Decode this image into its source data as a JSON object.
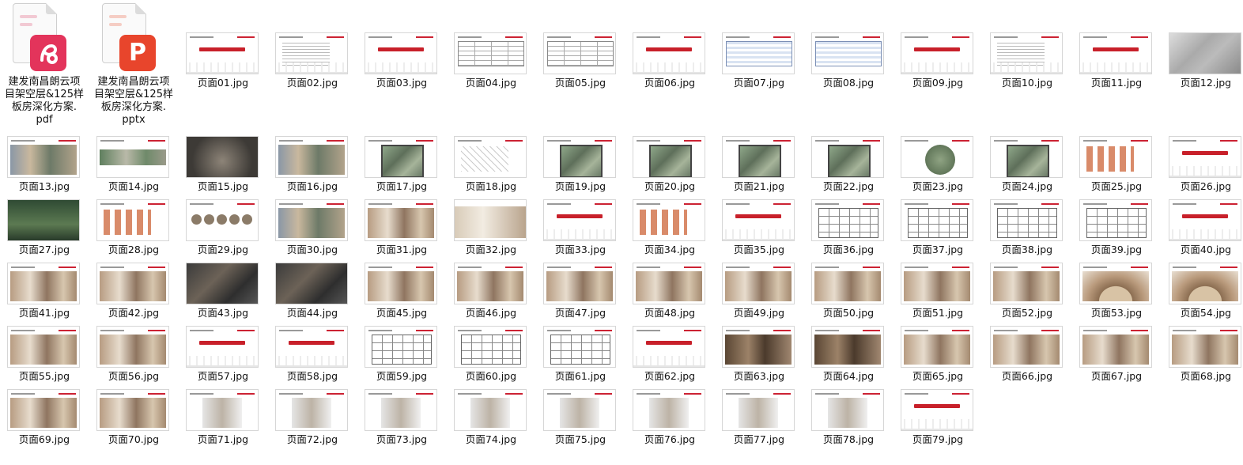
{
  "files": [
    {
      "name_lines": [
        "建发南昌朗云项",
        "目架空层&125样",
        "板房深化方案.",
        "pdf"
      ],
      "type": "pdf",
      "icon": "pdf-file-icon",
      "accent": "#e3345b",
      "glyph": "P"
    },
    {
      "name_lines": [
        "建发南昌朗云项",
        "目架空层&125样",
        "板房深化方案.",
        "pptx"
      ],
      "type": "pptx",
      "icon": "pptx-file-icon",
      "accent": "#e8452c",
      "glyph": "P"
    }
  ],
  "thumbnails": [
    {
      "label": "页面01.jpg",
      "kind": "cover"
    },
    {
      "label": "页面02.jpg",
      "kind": "lines"
    },
    {
      "label": "页面03.jpg",
      "kind": "cover"
    },
    {
      "label": "页面04.jpg",
      "kind": "table"
    },
    {
      "label": "页面05.jpg",
      "kind": "table"
    },
    {
      "label": "页面06.jpg",
      "kind": "cover"
    },
    {
      "label": "页面07.jpg",
      "kind": "bluetable"
    },
    {
      "label": "页面08.jpg",
      "kind": "bluetable"
    },
    {
      "label": "页面09.jpg",
      "kind": "cover"
    },
    {
      "label": "页面10.jpg",
      "kind": "lines"
    },
    {
      "label": "页面11.jpg",
      "kind": "cover"
    },
    {
      "label": "页面12.jpg",
      "kind": "map"
    },
    {
      "label": "页面13.jpg",
      "kind": "photo"
    },
    {
      "label": "页面14.jpg",
      "kind": "photo-green"
    },
    {
      "label": "页面15.jpg",
      "kind": "dark"
    },
    {
      "label": "页面16.jpg",
      "kind": "photo"
    },
    {
      "label": "页面17.jpg",
      "kind": "siteplan"
    },
    {
      "label": "页面18.jpg",
      "kind": "sketch"
    },
    {
      "label": "页面19.jpg",
      "kind": "siteplan"
    },
    {
      "label": "页面20.jpg",
      "kind": "siteplan"
    },
    {
      "label": "页面21.jpg",
      "kind": "siteplan"
    },
    {
      "label": "页面22.jpg",
      "kind": "siteplan"
    },
    {
      "label": "页面23.jpg",
      "kind": "circle"
    },
    {
      "label": "页面24.jpg",
      "kind": "siteplan"
    },
    {
      "label": "页面25.jpg",
      "kind": "diagram"
    },
    {
      "label": "页面26.jpg",
      "kind": "cover"
    },
    {
      "label": "页面27.jpg",
      "kind": "dark-green"
    },
    {
      "label": "页面28.jpg",
      "kind": "diagram"
    },
    {
      "label": "页面29.jpg",
      "kind": "circles"
    },
    {
      "label": "页面30.jpg",
      "kind": "photo"
    },
    {
      "label": "页面31.jpg",
      "kind": "interior"
    },
    {
      "label": "页面32.jpg",
      "kind": "interior-wide"
    },
    {
      "label": "页面33.jpg",
      "kind": "cover"
    },
    {
      "label": "页面34.jpg",
      "kind": "diagram"
    },
    {
      "label": "页面35.jpg",
      "kind": "cover"
    },
    {
      "label": "页面36.jpg",
      "kind": "plan"
    },
    {
      "label": "页面37.jpg",
      "kind": "plan"
    },
    {
      "label": "页面38.jpg",
      "kind": "plan"
    },
    {
      "label": "页面39.jpg",
      "kind": "plan"
    },
    {
      "label": "页面40.jpg",
      "kind": "cover"
    },
    {
      "label": "页面41.jpg",
      "kind": "interior"
    },
    {
      "label": "页面42.jpg",
      "kind": "interior"
    },
    {
      "label": "页面43.jpg",
      "kind": "model"
    },
    {
      "label": "页面44.jpg",
      "kind": "model"
    },
    {
      "label": "页面45.jpg",
      "kind": "interior"
    },
    {
      "label": "页面46.jpg",
      "kind": "interior"
    },
    {
      "label": "页面47.jpg",
      "kind": "interior"
    },
    {
      "label": "页面48.jpg",
      "kind": "interior"
    },
    {
      "label": "页面49.jpg",
      "kind": "interior"
    },
    {
      "label": "页面50.jpg",
      "kind": "interior"
    },
    {
      "label": "页面51.jpg",
      "kind": "interior"
    },
    {
      "label": "页面52.jpg",
      "kind": "interior"
    },
    {
      "label": "页面53.jpg",
      "kind": "arch"
    },
    {
      "label": "页面54.jpg",
      "kind": "arch"
    },
    {
      "label": "页面55.jpg",
      "kind": "interior"
    },
    {
      "label": "页面56.jpg",
      "kind": "interior"
    },
    {
      "label": "页面57.jpg",
      "kind": "cover"
    },
    {
      "label": "页面58.jpg",
      "kind": "cover"
    },
    {
      "label": "页面59.jpg",
      "kind": "plan"
    },
    {
      "label": "页面60.jpg",
      "kind": "plan"
    },
    {
      "label": "页面61.jpg",
      "kind": "plan"
    },
    {
      "label": "页面62.jpg",
      "kind": "cover"
    },
    {
      "label": "页面63.jpg",
      "kind": "interior-dark"
    },
    {
      "label": "页面64.jpg",
      "kind": "interior-dark"
    },
    {
      "label": "页面65.jpg",
      "kind": "interior"
    },
    {
      "label": "页面66.jpg",
      "kind": "interior"
    },
    {
      "label": "页面67.jpg",
      "kind": "interior"
    },
    {
      "label": "页面68.jpg",
      "kind": "interior"
    },
    {
      "label": "页面69.jpg",
      "kind": "interior"
    },
    {
      "label": "页面70.jpg",
      "kind": "interior"
    },
    {
      "label": "页面71.jpg",
      "kind": "light"
    },
    {
      "label": "页面72.jpg",
      "kind": "light"
    },
    {
      "label": "页面73.jpg",
      "kind": "light"
    },
    {
      "label": "页面74.jpg",
      "kind": "light"
    },
    {
      "label": "页面75.jpg",
      "kind": "light"
    },
    {
      "label": "页面76.jpg",
      "kind": "light"
    },
    {
      "label": "页面77.jpg",
      "kind": "light"
    },
    {
      "label": "页面78.jpg",
      "kind": "light"
    },
    {
      "label": "页面79.jpg",
      "kind": "cover"
    }
  ]
}
